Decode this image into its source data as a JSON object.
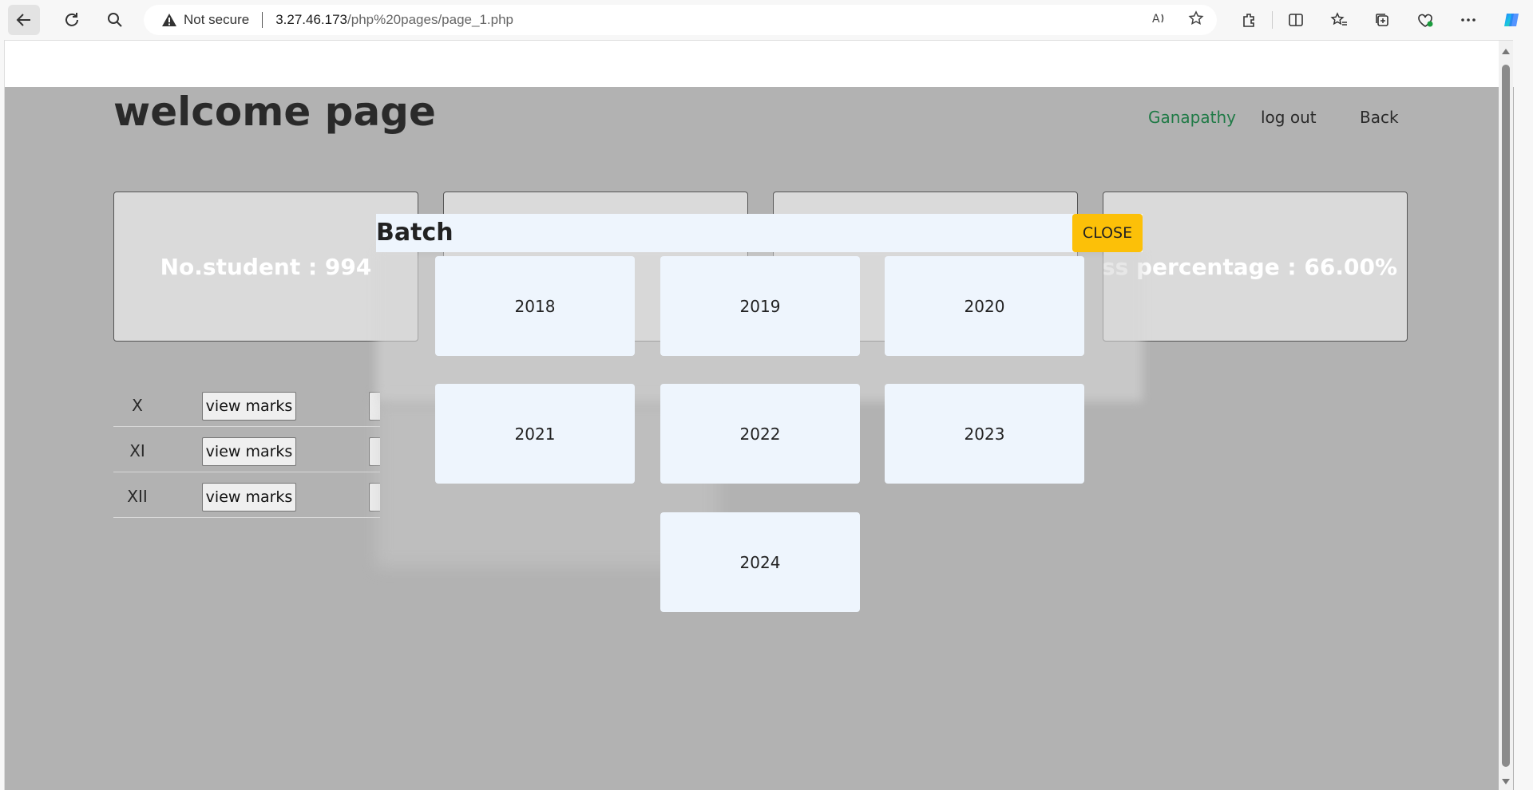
{
  "browser": {
    "security_label": "Not secure",
    "url_host": "3.27.46.173",
    "url_path": "/php%20pages/page_1.php"
  },
  "page": {
    "title": "welcome page",
    "nav": {
      "user": "Ganapathy",
      "logout": "log out",
      "back": "Back"
    },
    "cards": [
      {
        "text": "No.student : 994"
      },
      {
        "text": ""
      },
      {
        "text": ""
      },
      {
        "text": "ss percentage : 66.00%"
      }
    ],
    "classes": [
      {
        "name": "X",
        "button": "view marks"
      },
      {
        "name": "XI",
        "button": "view marks"
      },
      {
        "name": "XII",
        "button": "view marks"
      }
    ]
  },
  "modal": {
    "title": "Batch",
    "close_label": "CLOSE",
    "years": [
      "2018",
      "2019",
      "2020",
      "2021",
      "2022",
      "2023",
      "2024"
    ]
  },
  "colors": {
    "accent_user": "#1f7a46",
    "close_button": "#fcc008",
    "overlay": "#b2b2b2",
    "tile": "#eef5fd"
  }
}
